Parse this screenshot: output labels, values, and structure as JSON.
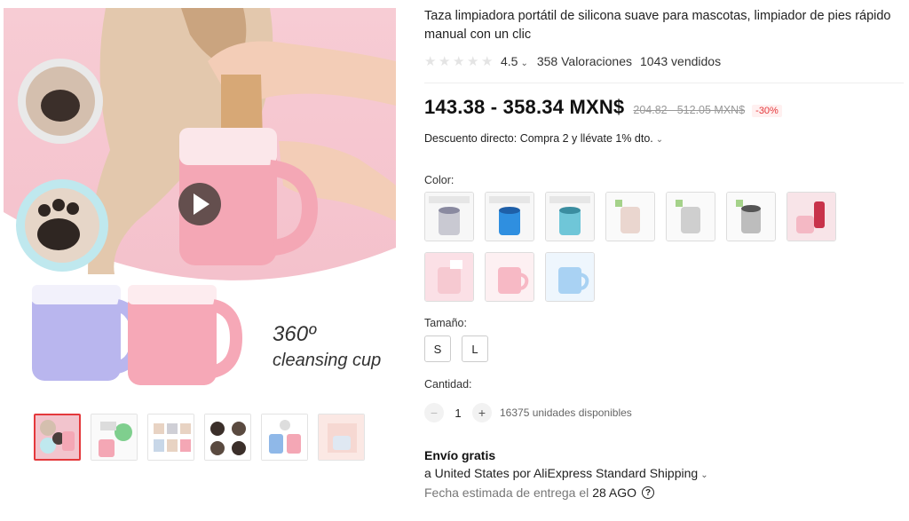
{
  "gallery": {
    "overlay_line1": "360º",
    "overlay_line2": "cleansing cup",
    "thumbnails": [
      "thumb-1",
      "thumb-2",
      "thumb-3",
      "thumb-4",
      "thumb-5",
      "thumb-6"
    ],
    "active_thumbnail": 0
  },
  "product": {
    "title": "Taza limpiadora portátil de silicona suave para mascotas, limpiador de pies rápido manual con un clic",
    "rating": "4.5",
    "rating_chevron": "⌄",
    "reviews": "358 Valoraciones",
    "sold": "1043 vendidos",
    "star_icons": [
      "star-icon",
      "star-icon",
      "star-icon",
      "star-icon",
      "star-icon"
    ]
  },
  "pricing": {
    "price": "143.38 - 358.34 MXN$",
    "old_price": "204.82 - 512.05 MXN$",
    "discount": "-30%",
    "promo": "Descuento directo: Compra 2 y llévate 1% dto.",
    "promo_chevron": "⌄"
  },
  "options": {
    "color_label": "Color:",
    "size_label": "Tamaño:",
    "sizes": [
      "S",
      "L"
    ]
  },
  "quantity": {
    "label": "Cantidad:",
    "minus": "−",
    "plus": "+",
    "value": "1",
    "stock": "16375 unidades disponibles"
  },
  "shipping": {
    "title": "Envío gratis",
    "destination": "a United States por AliExpress Standard Shipping",
    "destination_chevron": "⌄",
    "delivery_label": "Fecha estimada de entrega el",
    "delivery_date": "28 AGO",
    "help_glyph": "?"
  },
  "colors": {
    "pink": "#f6c9d1",
    "blue": "#2f8fe0",
    "accent_red": "#e4393c"
  }
}
